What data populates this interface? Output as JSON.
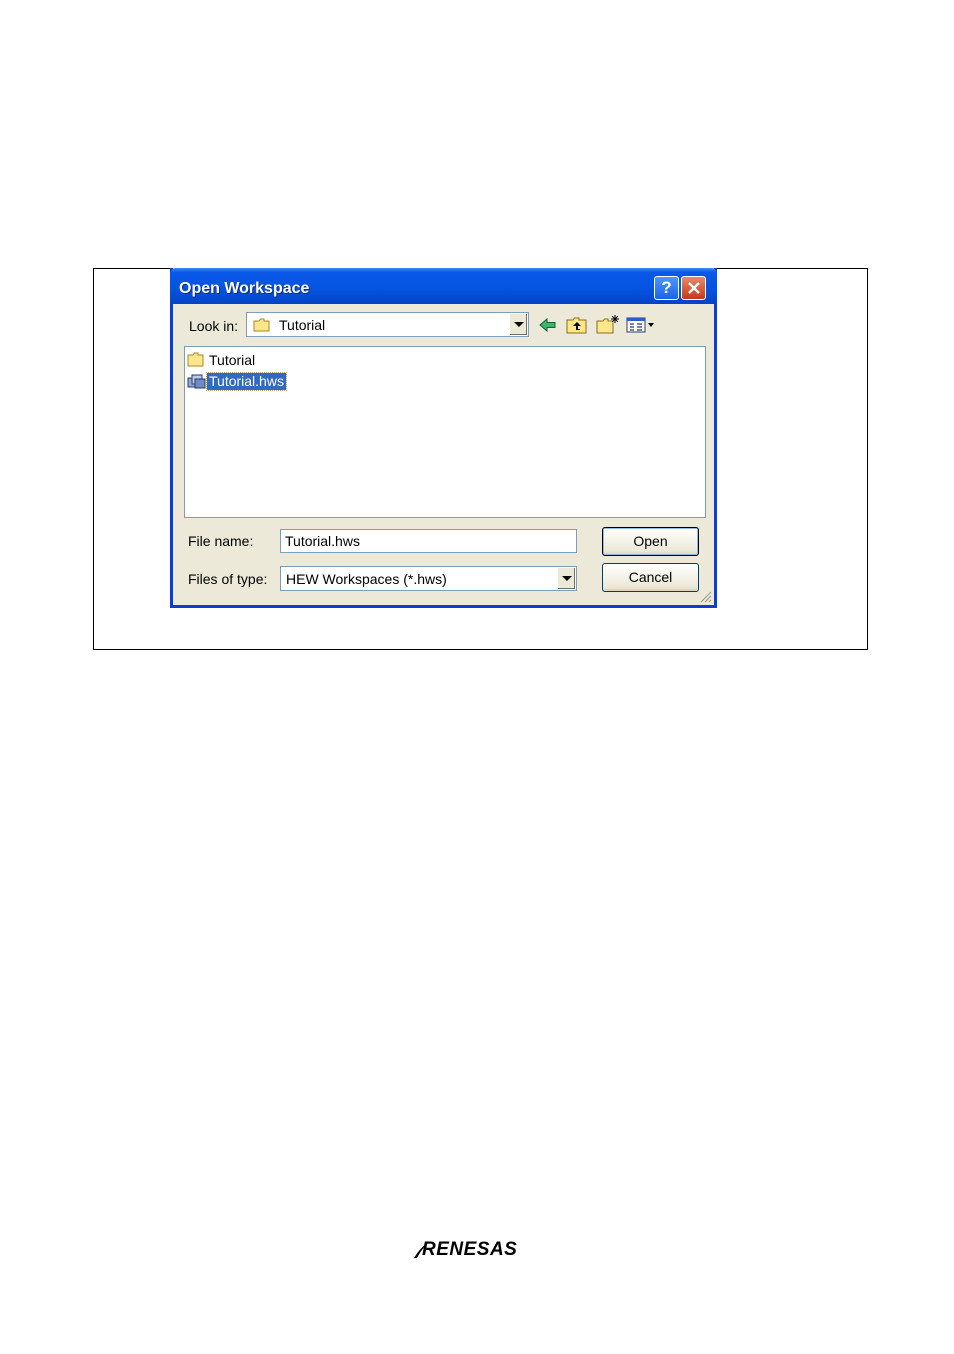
{
  "window": {
    "title": "Open Workspace",
    "help_label": "?",
    "close_label": "×"
  },
  "look_in": {
    "label": "Look in:",
    "value": "Tutorial"
  },
  "toolbar": {
    "icons": [
      "back-arrow-icon",
      "up-one-level-icon",
      "new-folder-icon",
      "view-menu-icon"
    ]
  },
  "files": [
    {
      "name": "Tutorial",
      "type": "folder",
      "selected": false
    },
    {
      "name": "Tutorial.hws",
      "type": "workspace",
      "selected": true
    }
  ],
  "file_name": {
    "label": "File name:",
    "value": "Tutorial.hws"
  },
  "file_type": {
    "label": "Files of type:",
    "value": "HEW Workspaces (*.hws)"
  },
  "buttons": {
    "open": "Open",
    "cancel": "Cancel"
  },
  "footer": {
    "logo_text": "RENESAS"
  }
}
